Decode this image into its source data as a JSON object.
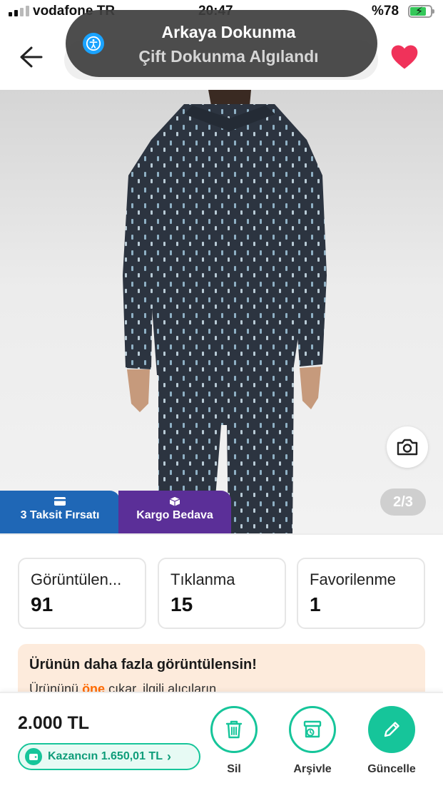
{
  "status_bar": {
    "carrier": "vodafone TR",
    "time": "20:47",
    "battery_text": "%78",
    "battery_level": 0.78
  },
  "header": {
    "back_icon": "arrow-left-icon",
    "favorite_icon": "heart-icon",
    "favorite_color": "#f0325a"
  },
  "accessibility_banner": {
    "icon": "accessibility-icon",
    "title": "Arkaya Dokunma",
    "subtitle": "Çift Dokunma Algılandı"
  },
  "gallery": {
    "current_page": "2/3",
    "camera_icon": "camera-icon",
    "badges": [
      {
        "label": "3 Taksit Fırsatı",
        "icon": "credit-card-icon",
        "color": "#1f67b6"
      },
      {
        "label": "Kargo Bedava",
        "icon": "package-icon",
        "color": "#5b2f98"
      }
    ]
  },
  "stats": [
    {
      "label": "Görüntülen...",
      "value": "91"
    },
    {
      "label": "Tıklanma",
      "value": "15"
    },
    {
      "label": "Favorilenme",
      "value": "1"
    }
  ],
  "promo": {
    "title": "Ürünün daha fazla görüntülensin!",
    "text_before": "Ürününü ",
    "text_highlight": "öne",
    "text_after": " çıkar, ilgili alıcıların"
  },
  "bottom_bar": {
    "price": "2.000 TL",
    "earnings": "Kazancın 1.650,01 TL",
    "accent_color": "#16c59a",
    "actions": [
      {
        "label": "Sil",
        "icon": "trash-icon"
      },
      {
        "label": "Arşivle",
        "icon": "archive-icon"
      },
      {
        "label": "Güncelle",
        "icon": "pencil-icon"
      }
    ]
  }
}
